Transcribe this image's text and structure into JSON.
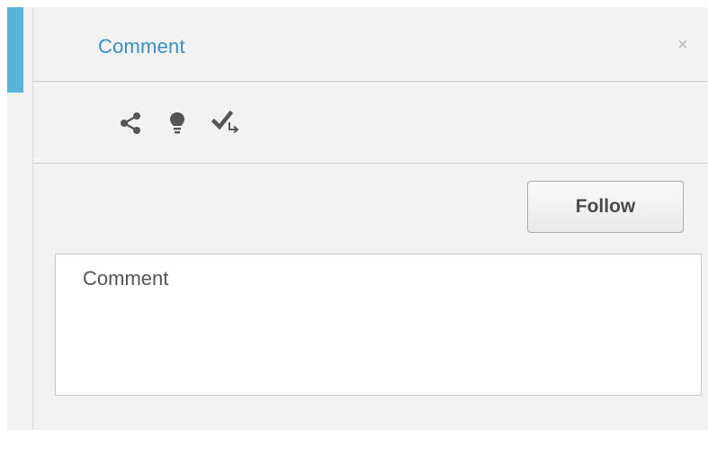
{
  "panel": {
    "title": "Comment",
    "close_glyph": "×"
  },
  "toolbar": {
    "items": [
      {
        "icon": "share-icon"
      },
      {
        "icon": "lightbulb-icon"
      },
      {
        "icon": "check-forward-icon"
      }
    ]
  },
  "follow": {
    "label": "Follow"
  },
  "comment": {
    "placeholder": "Comment",
    "value": ""
  },
  "colors": {
    "accent": "#5cb3d9",
    "title": "#3a8fc4",
    "icon": "#555555"
  }
}
